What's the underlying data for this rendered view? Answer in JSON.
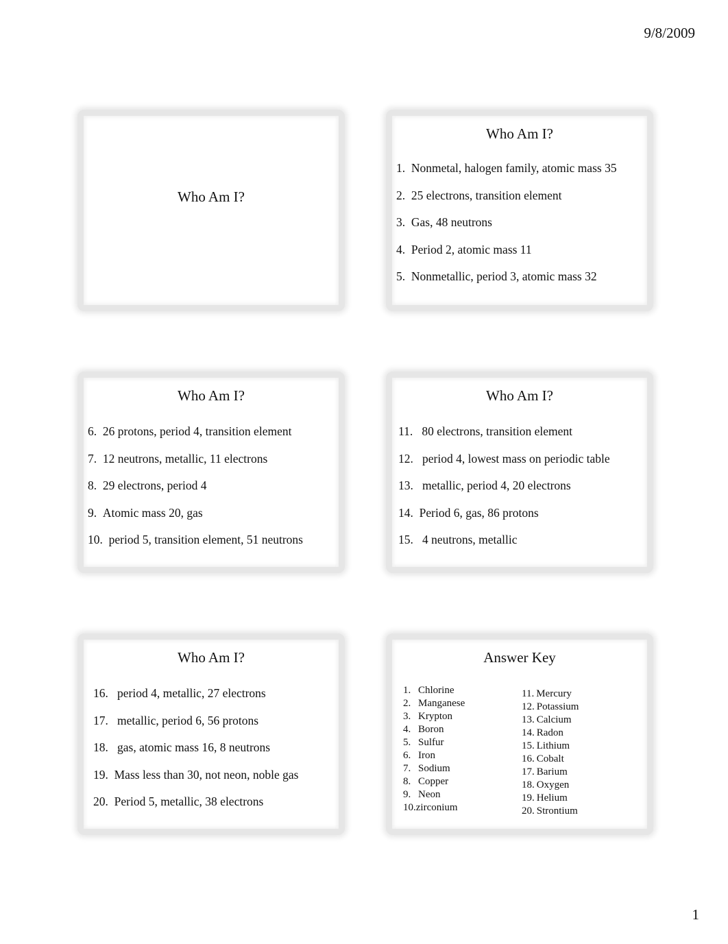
{
  "header": {
    "date": "9/8/2009"
  },
  "footer": {
    "page_number": "1"
  },
  "slides": [
    {
      "title": "Who Am I?"
    },
    {
      "title": "Who Am I?",
      "items": [
        {
          "num": "1.",
          "text": "Nonmetal, halogen family, atomic mass 35"
        },
        {
          "num": "2.",
          "text": "25 electrons, transition element"
        },
        {
          "num": "3.",
          "text": "Gas, 48 neutrons"
        },
        {
          "num": "4.",
          "text": "Period 2, atomic mass 11"
        },
        {
          "num": "5.",
          "text": "Nonmetallic, period 3, atomic mass 32"
        }
      ]
    },
    {
      "title": "Who Am I?",
      "items": [
        {
          "num": "6.",
          "text": "26 protons, period 4, transition element"
        },
        {
          "num": "7.",
          "text": "12 neutrons, metallic, 11 electrons"
        },
        {
          "num": "8.",
          "text": "29 electrons, period 4"
        },
        {
          "num": "9.",
          "text": "Atomic mass 20, gas"
        },
        {
          "num": "10.",
          "text": "period 5, transition element, 51 neutrons"
        }
      ]
    },
    {
      "title": "Who Am I?",
      "items": [
        {
          "num": "11.",
          "text": " 80 electrons, transition element"
        },
        {
          "num": "12.",
          "text": " period 4, lowest mass on periodic table"
        },
        {
          "num": "13.",
          "text": " metallic, period 4, 20 electrons"
        },
        {
          "num": "14.",
          "text": "Period 6, gas, 86 protons"
        },
        {
          "num": "15.",
          "text": " 4 neutrons, metallic"
        }
      ]
    },
    {
      "title": "Who Am I?",
      "items": [
        {
          "num": "16.",
          "text": " period 4, metallic, 27 electrons"
        },
        {
          "num": "17.",
          "text": " metallic, period 6, 56 protons"
        },
        {
          "num": "18.",
          "text": " gas, atomic mass 16, 8 neutrons"
        },
        {
          "num": "19.",
          "text": "Mass less than 30, not neon, noble gas"
        },
        {
          "num": "20.",
          "text": "Period 5, metallic, 38 electrons"
        }
      ]
    },
    {
      "title": "Answer Key",
      "left": [
        {
          "num": "1.",
          "text": "Chlorine"
        },
        {
          "num": "2.",
          "text": "Manganese"
        },
        {
          "num": "3.",
          "text": "Krypton"
        },
        {
          "num": "4.",
          "text": "Boron"
        },
        {
          "num": "5.",
          "text": "Sulfur"
        },
        {
          "num": "6.",
          "text": "Iron"
        },
        {
          "num": "7.",
          "text": "Sodium"
        },
        {
          "num": "8.",
          "text": "Copper"
        },
        {
          "num": "9.",
          "text": "Neon"
        },
        {
          "num": "10.",
          "text": "zirconium"
        }
      ],
      "right": [
        {
          "num": "11.",
          "text": "Mercury"
        },
        {
          "num": "12.",
          "text": "Potassium"
        },
        {
          "num": "13.",
          "text": "Calcium"
        },
        {
          "num": "14.",
          "text": "Radon"
        },
        {
          "num": "15.",
          "text": "Lithium"
        },
        {
          "num": "16.",
          "text": "Cobalt"
        },
        {
          "num": "17.",
          "text": "Barium"
        },
        {
          "num": "18.",
          "text": "Oxygen"
        },
        {
          "num": "19.",
          "text": "Helium"
        },
        {
          "num": "20.",
          "text": "Strontium"
        }
      ]
    }
  ]
}
